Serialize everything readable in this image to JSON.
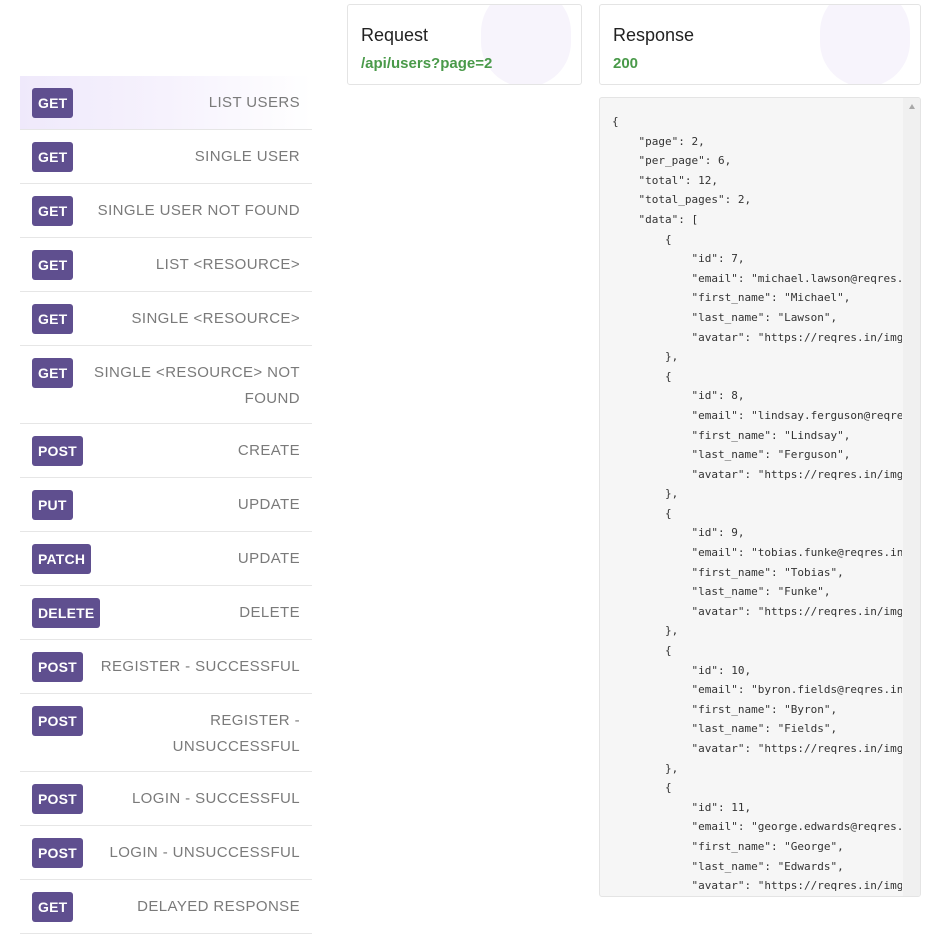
{
  "endpoints": [
    {
      "method": "GET",
      "label": "LIST USERS",
      "active": true
    },
    {
      "method": "GET",
      "label": "SINGLE USER"
    },
    {
      "method": "GET",
      "label": "SINGLE USER NOT FOUND"
    },
    {
      "method": "GET",
      "label": "LIST <RESOURCE>"
    },
    {
      "method": "GET",
      "label": "SINGLE <RESOURCE>"
    },
    {
      "method": "GET",
      "label": "SINGLE <RESOURCE> NOT FOUND"
    },
    {
      "method": "POST",
      "label": "CREATE"
    },
    {
      "method": "PUT",
      "label": "UPDATE"
    },
    {
      "method": "PATCH",
      "label": "UPDATE"
    },
    {
      "method": "DELETE",
      "label": "DELETE"
    },
    {
      "method": "POST",
      "label": "REGISTER - SUCCESSFUL"
    },
    {
      "method": "POST",
      "label": "REGISTER - UNSUCCESSFUL"
    },
    {
      "method": "POST",
      "label": "LOGIN - SUCCESSFUL"
    },
    {
      "method": "POST",
      "label": "LOGIN - UNSUCCESSFUL"
    },
    {
      "method": "GET",
      "label": "DELAYED RESPONSE"
    }
  ],
  "request": {
    "title": "Request",
    "url": "/api/users?page=2"
  },
  "response": {
    "title": "Response",
    "status": "200",
    "body": "{\n    \"page\": 2,\n    \"per_page\": 6,\n    \"total\": 12,\n    \"total_pages\": 2,\n    \"data\": [\n        {\n            \"id\": 7,\n            \"email\": \"michael.lawson@reqres.\n            \"first_name\": \"Michael\",\n            \"last_name\": \"Lawson\",\n            \"avatar\": \"https://reqres.in/img\n        },\n        {\n            \"id\": 8,\n            \"email\": \"lindsay.ferguson@reqre\n            \"first_name\": \"Lindsay\",\n            \"last_name\": \"Ferguson\",\n            \"avatar\": \"https://reqres.in/img\n        },\n        {\n            \"id\": 9,\n            \"email\": \"tobias.funke@reqres.in\n            \"first_name\": \"Tobias\",\n            \"last_name\": \"Funke\",\n            \"avatar\": \"https://reqres.in/img\n        },\n        {\n            \"id\": 10,\n            \"email\": \"byron.fields@reqres.in\n            \"first_name\": \"Byron\",\n            \"last_name\": \"Fields\",\n            \"avatar\": \"https://reqres.in/img\n        },\n        {\n            \"id\": 11,\n            \"email\": \"george.edwards@reqres.\n            \"first_name\": \"George\",\n            \"last_name\": \"Edwards\",\n            \"avatar\": \"https://reqres.in/img"
  }
}
